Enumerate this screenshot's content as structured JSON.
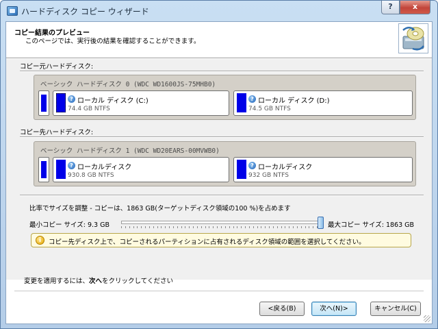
{
  "window": {
    "title": "ハードディスク コピー ウィザード",
    "help_label": "?",
    "close_label": "x"
  },
  "header": {
    "title": "コピー結果のプレビュー",
    "subtitle": "このページでは、実行後の結果を確認することができます。"
  },
  "source": {
    "label": "コピー元ハードディスク:",
    "disk_title": "ベーシック ハードディスク 0 (WDC WD1600JS-75MHB0)",
    "partitions": [
      {
        "name": "ローカル ディスク (C:)",
        "size": "74.4 GB NTFS"
      },
      {
        "name": "ローカル ディスク (D:)",
        "size": "74.5 GB NTFS"
      }
    ]
  },
  "target": {
    "label": "コピー先ハードディスク:",
    "disk_title": "ベーシック ハードディスク 1 (WDC WD20EARS-00MVWB0)",
    "partitions": [
      {
        "name": "ローカルディスク",
        "size": "930.8 GB NTFS"
      },
      {
        "name": "ローカルディスク",
        "size": "932 GB NTFS"
      }
    ]
  },
  "scale": {
    "title": "比率でサイズを調整 - コピーは、1863 GB(ターゲットディスク領域の100 %)を占めます",
    "min_label": "最小コピー サイズ:  9.3 GB",
    "max_label": "最大コピー サイズ:  1863 GB",
    "value_percent": 100,
    "info": "コピー先ディスク上で、コピーされるパーティションに占有されるディスク領域の範囲を選択してください。"
  },
  "footer": {
    "text_before": "変更を適用するには、",
    "text_bold": "次へ",
    "text_after": "をクリックしてください"
  },
  "buttons": {
    "back": "<戻る(B)",
    "next": "次へ(N)>",
    "cancel": "キャンセル(C)"
  },
  "icons": {
    "app": "disk-copy-icon",
    "wizard": "disk-copy-wizard-icon",
    "help": "question-icon",
    "info": "info-icon"
  },
  "colors": {
    "partition_fill": "#0000e8",
    "disk_panel": "#d4d0c8",
    "info_background": "#fffbe0"
  }
}
